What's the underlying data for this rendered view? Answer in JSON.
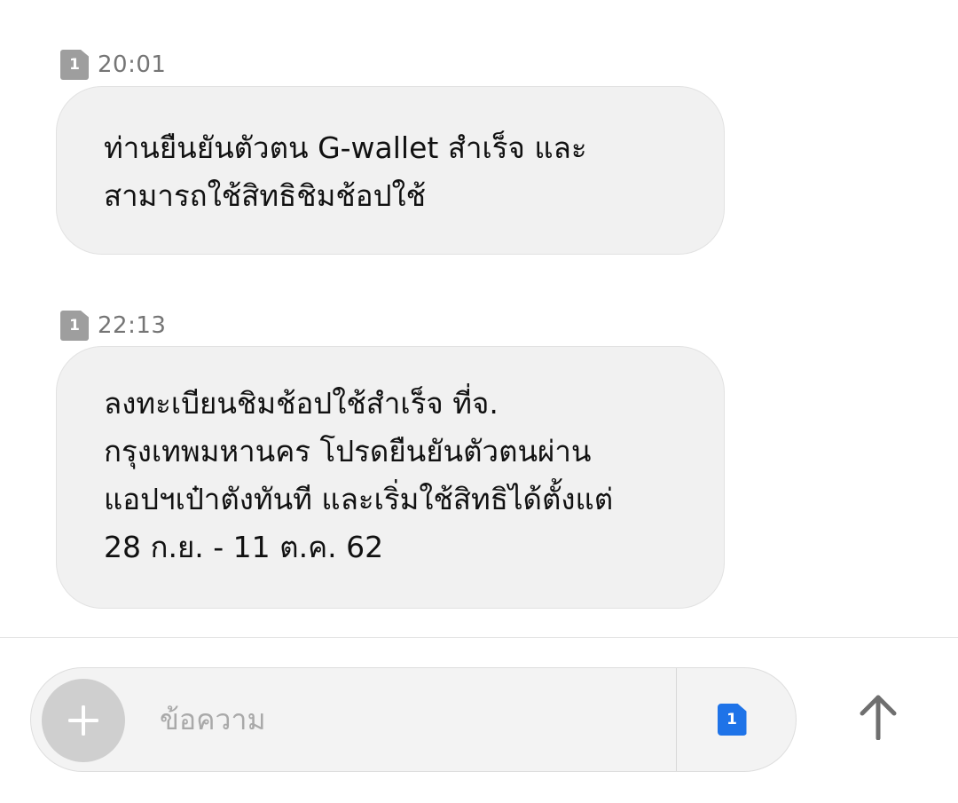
{
  "messages": [
    {
      "sim": "1",
      "time": "20:01",
      "lines": [
        "ท่านยืนยันตัวตน G-wallet สำเร็จ และ",
        "สามารถใช้สิทธิชิมช้อปใช้"
      ]
    },
    {
      "sim": "1",
      "time": "22:13",
      "lines": [
        "ลงทะเบียนชิมช้อปใช้สำเร็จ ที่จ.",
        "กรุงเทพมหานคร โปรดยืนยันตัวตนผ่าน",
        "แอปฯเป๋าตังทันที และเริ่มใช้สิทธิได้ตั้งแต่",
        "28 ก.ย. - 11 ต.ค. 62"
      ]
    }
  ],
  "composer": {
    "placeholder": "ข้อความ",
    "value": "",
    "add_icon": "plus-icon",
    "sim_selector": "1",
    "send_icon": "arrow-up-icon"
  },
  "colors": {
    "bubble_bg": "#f1f1f1",
    "sim_badge_gray": "#9e9e9e",
    "sim_badge_blue": "#1e73e8",
    "time_text": "#757575"
  }
}
